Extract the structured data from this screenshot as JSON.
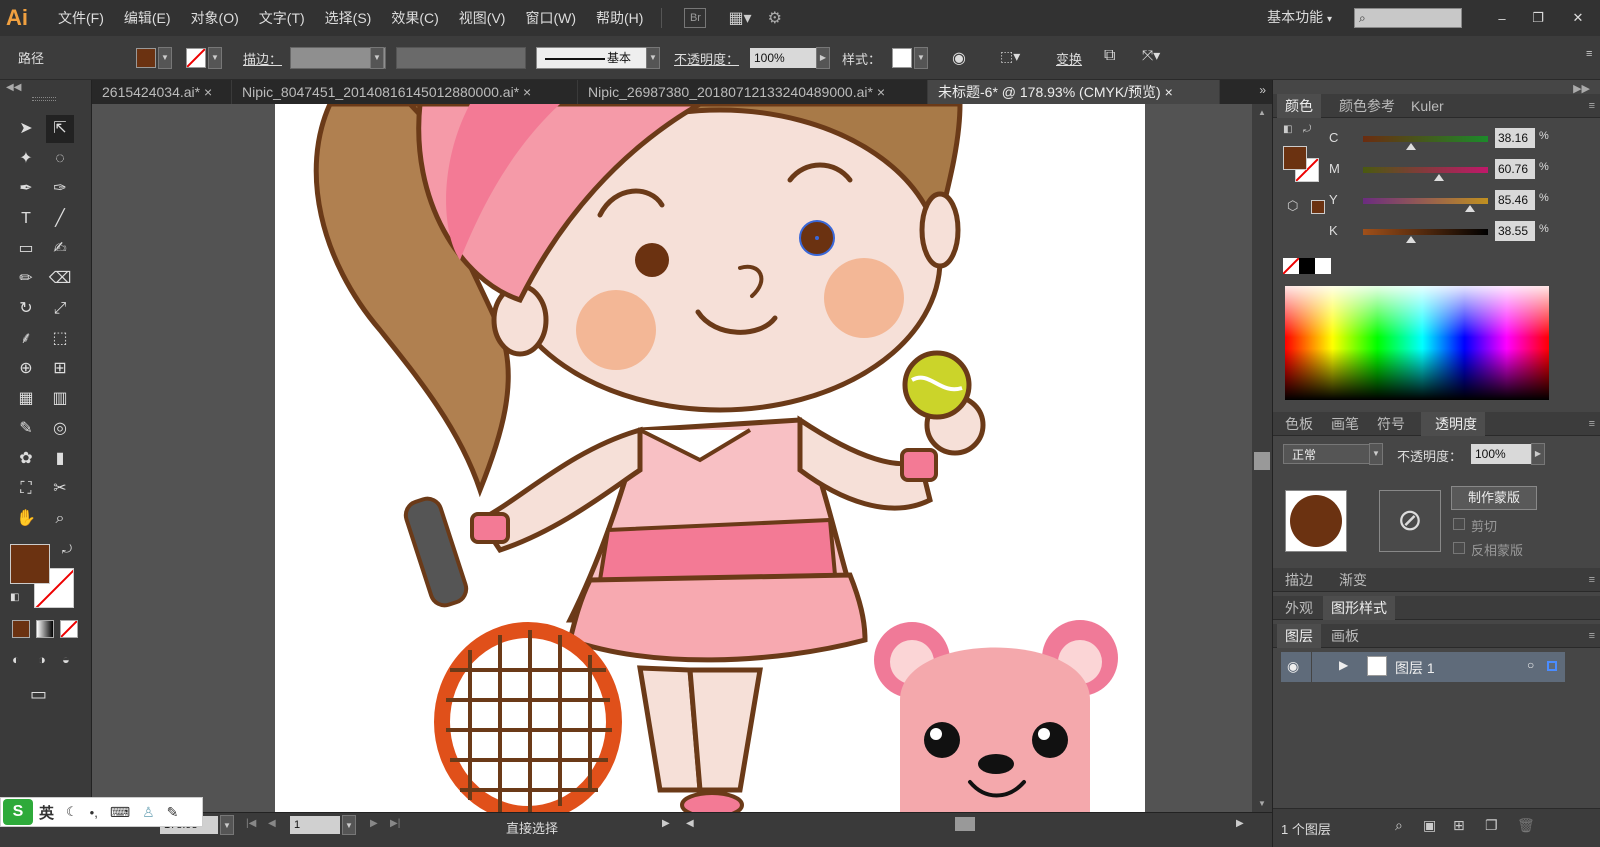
{
  "app": {
    "logo": "Ai",
    "workspace": "基本功能",
    "workspace_arrow": "▾"
  },
  "menu": [
    "文件(F)",
    "编辑(E)",
    "对象(O)",
    "文字(T)",
    "选择(S)",
    "效果(C)",
    "视图(V)",
    "窗口(W)",
    "帮助(H)"
  ],
  "menu_extra": {
    "bridge": "Br"
  },
  "control": {
    "object_type": "路径",
    "stroke_label": "描边：",
    "stroke_profile": "基本",
    "opacity_label": "不透明度：",
    "opacity": "100%",
    "style_label": "样式：",
    "transform_label": "变换",
    "fill_color": "#6b3211"
  },
  "tabs": [
    {
      "label": "2615424034.ai*",
      "close": "×"
    },
    {
      "label": "Nipic_8047451_20140816145012880000.ai*",
      "close": "×"
    },
    {
      "label": "Nipic_26987380_20180712133240489000.ai*",
      "close": "×"
    },
    {
      "label": "未标题-6* @ 178.93% (CMYK/预览)",
      "close": "×"
    }
  ],
  "tools": [
    "selection-tool",
    "direct-selection-tool",
    "magic-wand-tool",
    "lasso-tool",
    "pen-tool",
    "curvature-tool",
    "type-tool",
    "line-tool",
    "rectangle-tool",
    "paintbrush-tool",
    "pencil-tool",
    "eraser-tool",
    "rotate-tool",
    "scale-tool",
    "warp-tool",
    "free-transform-tool",
    "shape-builder-tool",
    "perspective-grid-tool",
    "mesh-tool",
    "gradient-tool",
    "eyedropper-tool",
    "blend-tool",
    "symbol-sprayer-tool",
    "column-graph-tool",
    "artboard-tool",
    "slice-tool",
    "hand-tool",
    "zoom-tool"
  ],
  "status": {
    "zoom": "178.93",
    "page": "1",
    "tool_name": "直接选择"
  },
  "color_panel": {
    "tabs": [
      "颜色",
      "颜色参考",
      "Kuler"
    ],
    "channels": [
      {
        "label": "C",
        "value": "38.16",
        "pct": 0.3816,
        "colors": [
          "#6b2c10",
          "#1c8a2a"
        ]
      },
      {
        "label": "M",
        "value": "60.76",
        "pct": 0.6076,
        "colors": [
          "#4a5a10",
          "#c0186a"
        ]
      },
      {
        "label": "Y",
        "value": "85.46",
        "pct": 0.8546,
        "colors": [
          "#6b2c80",
          "#c09020"
        ]
      },
      {
        "label": "K",
        "value": "38.55",
        "pct": 0.3855,
        "colors": [
          "#a0501a",
          "#000000"
        ]
      }
    ],
    "pct_sign": "%"
  },
  "transparency_panel": {
    "tabs": [
      "色板",
      "画笔",
      "符号",
      "透明度"
    ],
    "blend_mode": "正常",
    "opacity_label": "不透明度：",
    "opacity": "100%",
    "make_mask": "制作蒙版",
    "clip": "剪切",
    "invert": "反相蒙版"
  },
  "stroke_gradient_tabs": [
    "描边",
    "渐变"
  ],
  "appearance_tabs": [
    "外观",
    "图形样式"
  ],
  "layers_panel": {
    "tabs": [
      "图层",
      "画板"
    ],
    "layer_name": "图层 1",
    "count": "1 个图层"
  },
  "ime": {
    "lang": "英"
  }
}
